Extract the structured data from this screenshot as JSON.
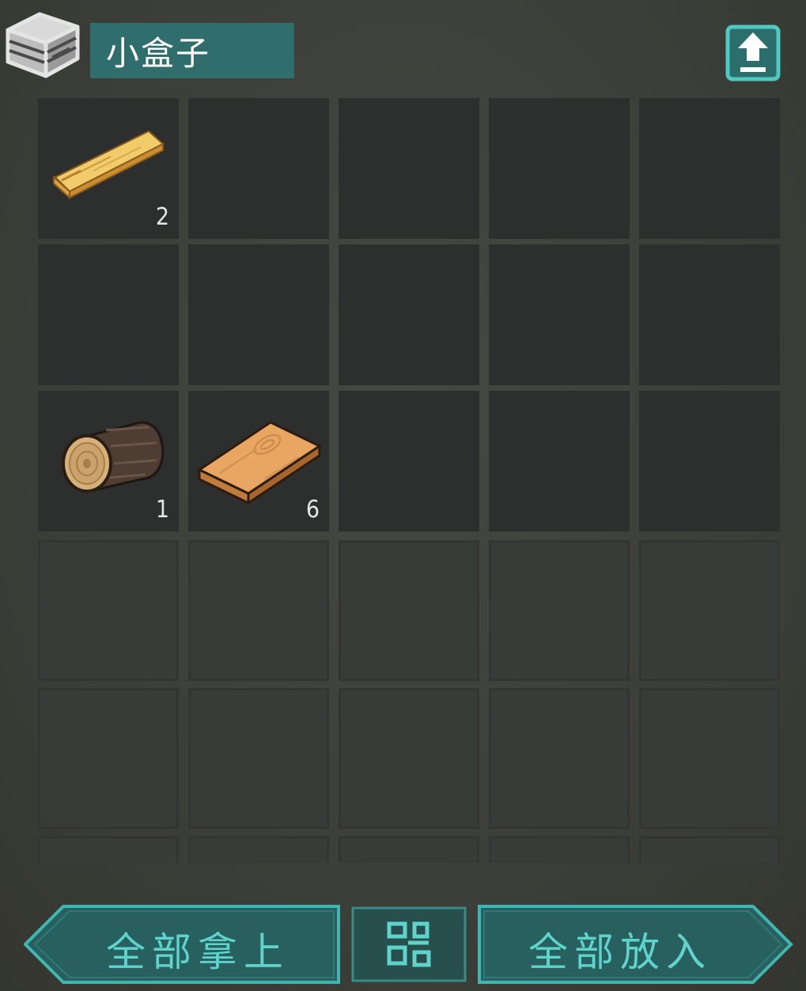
{
  "container": {
    "title": "小盒子",
    "box_icon": "storage-box-icon",
    "transfer_icon": "upload-arrow-icon"
  },
  "inventory": {
    "columns": 5,
    "slots": [
      {
        "item": "wooden-plank-light",
        "count": "2"
      },
      {
        "item": null,
        "count": ""
      },
      {
        "item": null,
        "count": ""
      },
      {
        "item": null,
        "count": ""
      },
      {
        "item": null,
        "count": ""
      },
      {
        "item": null,
        "count": ""
      },
      {
        "item": null,
        "count": ""
      },
      {
        "item": null,
        "count": ""
      },
      {
        "item": null,
        "count": ""
      },
      {
        "item": null,
        "count": ""
      },
      {
        "item": "wood-log",
        "count": "1"
      },
      {
        "item": "wooden-board",
        "count": "6"
      },
      {
        "item": null,
        "count": ""
      },
      {
        "item": null,
        "count": ""
      },
      {
        "item": null,
        "count": ""
      }
    ]
  },
  "actions": {
    "take_all_label": "全部拿上",
    "sort_icon": "grid-sort-icon",
    "put_all_label": "全部放入"
  },
  "colors": {
    "accent": "#5fd4cc",
    "button_fill": "#27605e",
    "title_plate": "#2f6e6c",
    "slot_filled": "#2c2f2e",
    "slot_empty": "#383c39"
  }
}
